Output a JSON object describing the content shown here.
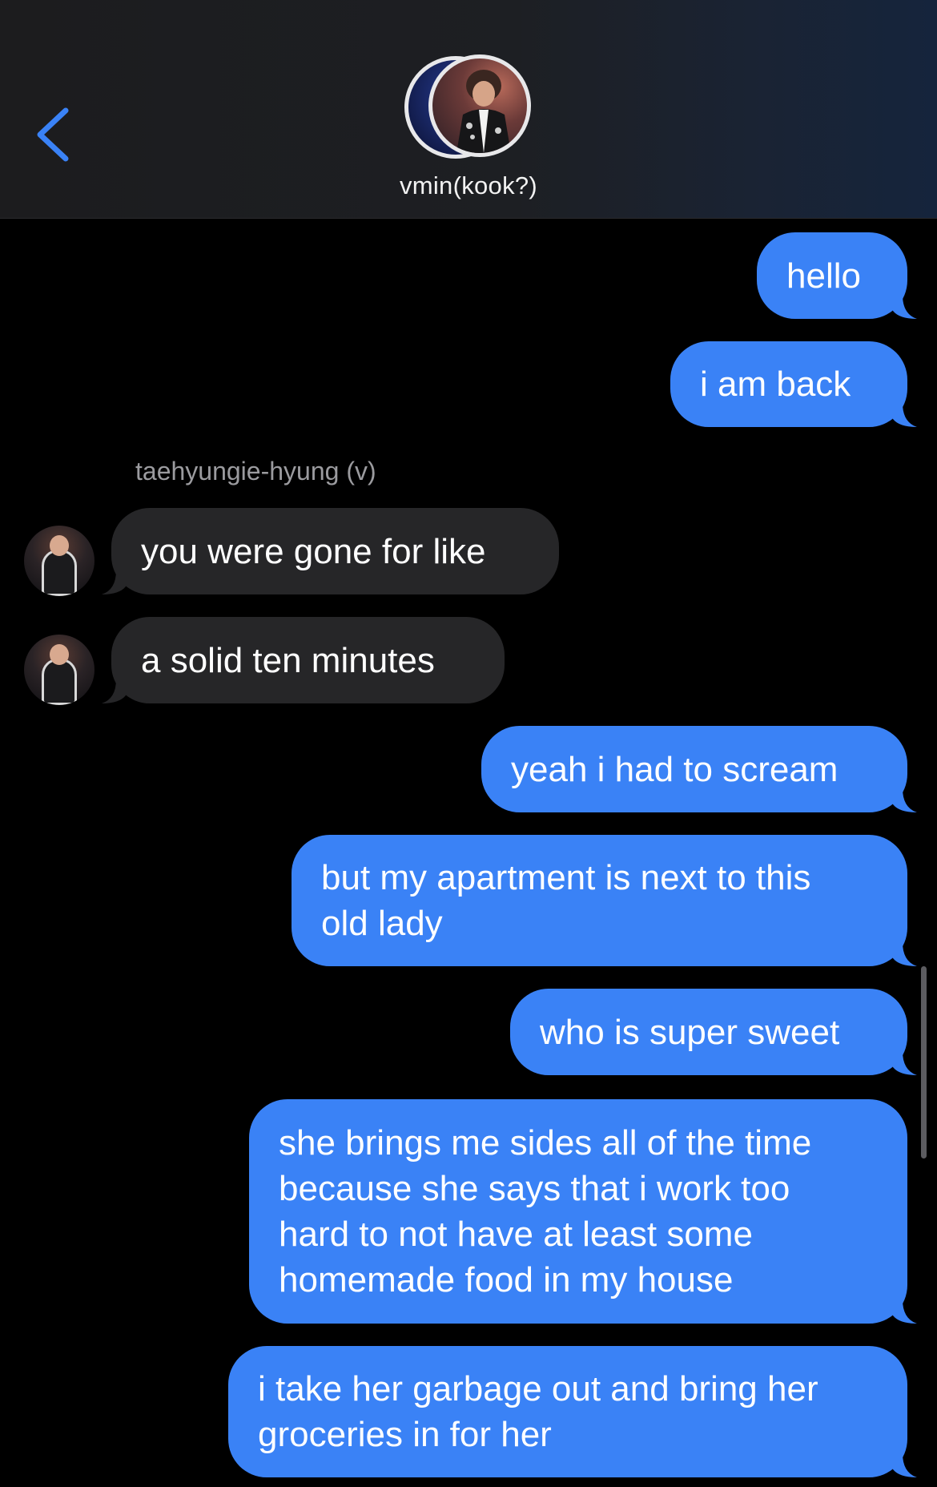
{
  "header": {
    "title": "vmin(kook?)"
  },
  "sender": {
    "name": "taehyungie-hyung (v)"
  },
  "messages": [
    {
      "from": "me",
      "lines": [
        "hello"
      ]
    },
    {
      "from": "me",
      "lines": [
        "i am back"
      ]
    },
    {
      "from": "them",
      "lines": [
        "you were gone for like"
      ]
    },
    {
      "from": "them",
      "lines": [
        "a solid ten minutes"
      ]
    },
    {
      "from": "me",
      "lines": [
        "yeah i had to scream"
      ]
    },
    {
      "from": "me",
      "lines": [
        "but my apartment is next to this",
        "old lady"
      ]
    },
    {
      "from": "me",
      "lines": [
        "who is super sweet"
      ]
    },
    {
      "from": "me",
      "lines": [
        "she brings me sides all of the time",
        "because she says that i work too",
        "hard to not have at least some",
        "homemade food in my house"
      ]
    },
    {
      "from": "me",
      "lines": [
        "i take her garbage out and bring her",
        "groceries in for her"
      ]
    }
  ],
  "colors": {
    "sent_bubble": "#3a82f6",
    "received_bubble": "#262628",
    "accent": "#3a82f6"
  },
  "icons": {
    "back": "chevron-left-icon"
  }
}
